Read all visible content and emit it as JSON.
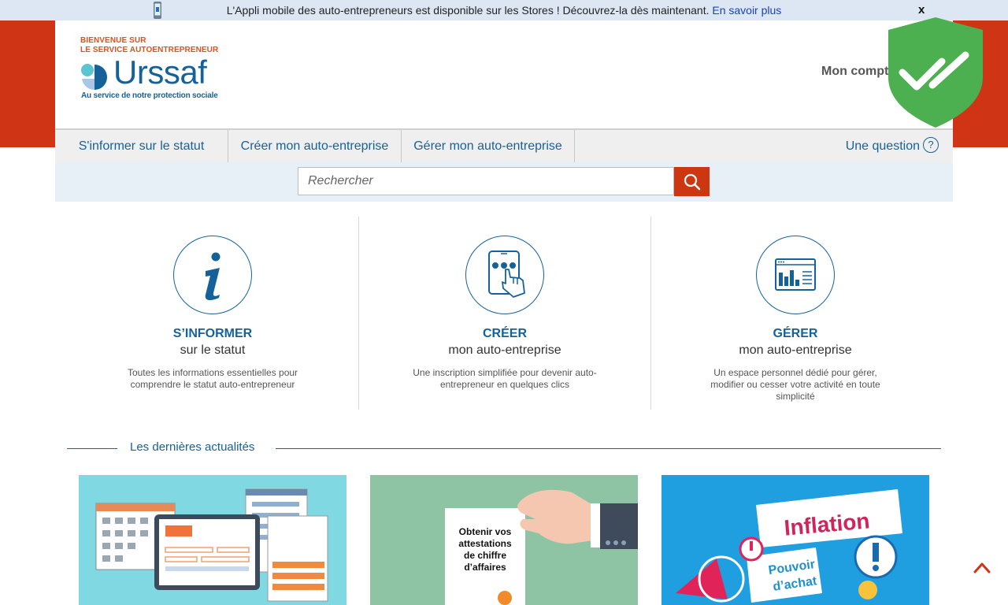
{
  "banner": {
    "message": "L'Appli mobile des auto-entrepreneurs est disponible sur les Stores ! Découvrez-la dès maintenant.",
    "link": "En savoir plus",
    "close": "x"
  },
  "header": {
    "welcome_line1": "BIENVENUE SUR",
    "welcome_line2": "LE SERVICE AUTOENTREPRENEUR",
    "brand": "Urssaf",
    "tagline": "Au service de notre protection sociale",
    "account": "Mon compte"
  },
  "nav": {
    "items": [
      {
        "label": "S'informer sur le statut"
      },
      {
        "label": "Créer mon auto-entreprise"
      },
      {
        "label": "Gérer mon auto-entreprise"
      }
    ],
    "question": "Une question",
    "question_icon": "?"
  },
  "search": {
    "placeholder": "Rechercher"
  },
  "features": [
    {
      "title": "S’INFORMER",
      "subtitle": "sur le statut",
      "description": "Toutes les informations essentielles pour comprendre le statut auto-entrepreneur",
      "icon": "info-icon"
    },
    {
      "title": "CRÉER",
      "subtitle": "mon auto-entreprise",
      "description": "Une inscription simplifiée pour devenir auto-entrepreneur en quelques clics",
      "icon": "touch-tablet-icon"
    },
    {
      "title": "GÉRER",
      "subtitle": "mon auto-entreprise",
      "description": "Un espace personnel dédié pour gérer, modifier ou cesser votre activité en toute simplicité",
      "icon": "dashboard-icon"
    }
  ],
  "news": {
    "title": "Les dernières actualités",
    "cards": [
      {
        "image": "calendar-tablet-illustration"
      },
      {
        "image": "attestation-illustration",
        "text_lines": [
          "Obtenir vos",
          "attestations",
          "de chiffre",
          "d’affaires"
        ]
      },
      {
        "image": "inflation-illustration",
        "word1": "Inflation",
        "word2_line1": "Pouvoir",
        "word2_line2": "d’achat"
      }
    ]
  },
  "colors": {
    "primary": "#15629b",
    "accent": "#cf3414",
    "banner_bg": "#dde7f4",
    "shield": "#4caf50"
  }
}
